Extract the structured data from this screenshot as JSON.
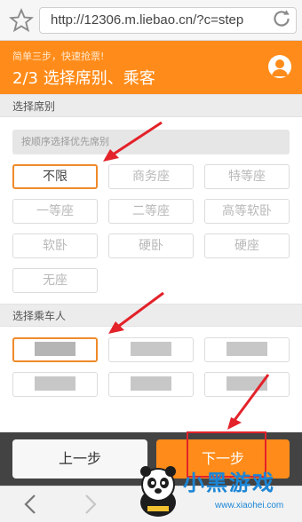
{
  "browser": {
    "url": "http://12306.m.liebao.cn/?c=step"
  },
  "header": {
    "hint": "简单三步，快速抢票!",
    "step_title": "2/3 选择席别、乘客"
  },
  "seat_section": {
    "label": "选择席别",
    "hint_placeholder": "按顺序选择优先席别",
    "options": [
      "不限",
      "商务座",
      "特等座",
      "一等座",
      "二等座",
      "高等软卧",
      "软卧",
      "硬卧",
      "硬座",
      "无座"
    ],
    "selected": "不限"
  },
  "passenger_section": {
    "label": "选择乘车人",
    "passenger_count": 6
  },
  "footer": {
    "prev_label": "上一步",
    "next_label": "下一步"
  },
  "watermark": {
    "text": "小黑游戏",
    "url": "www.xiaohei.com"
  },
  "colors": {
    "accent": "#ff8c1a",
    "highlight": "#e3222a",
    "selected_border": "#ef8a2a",
    "footer_bg": "#434343"
  },
  "icons": [
    "star-icon",
    "reload-icon",
    "avatar-icon",
    "back-arrow-icon",
    "forward-arrow-icon"
  ]
}
